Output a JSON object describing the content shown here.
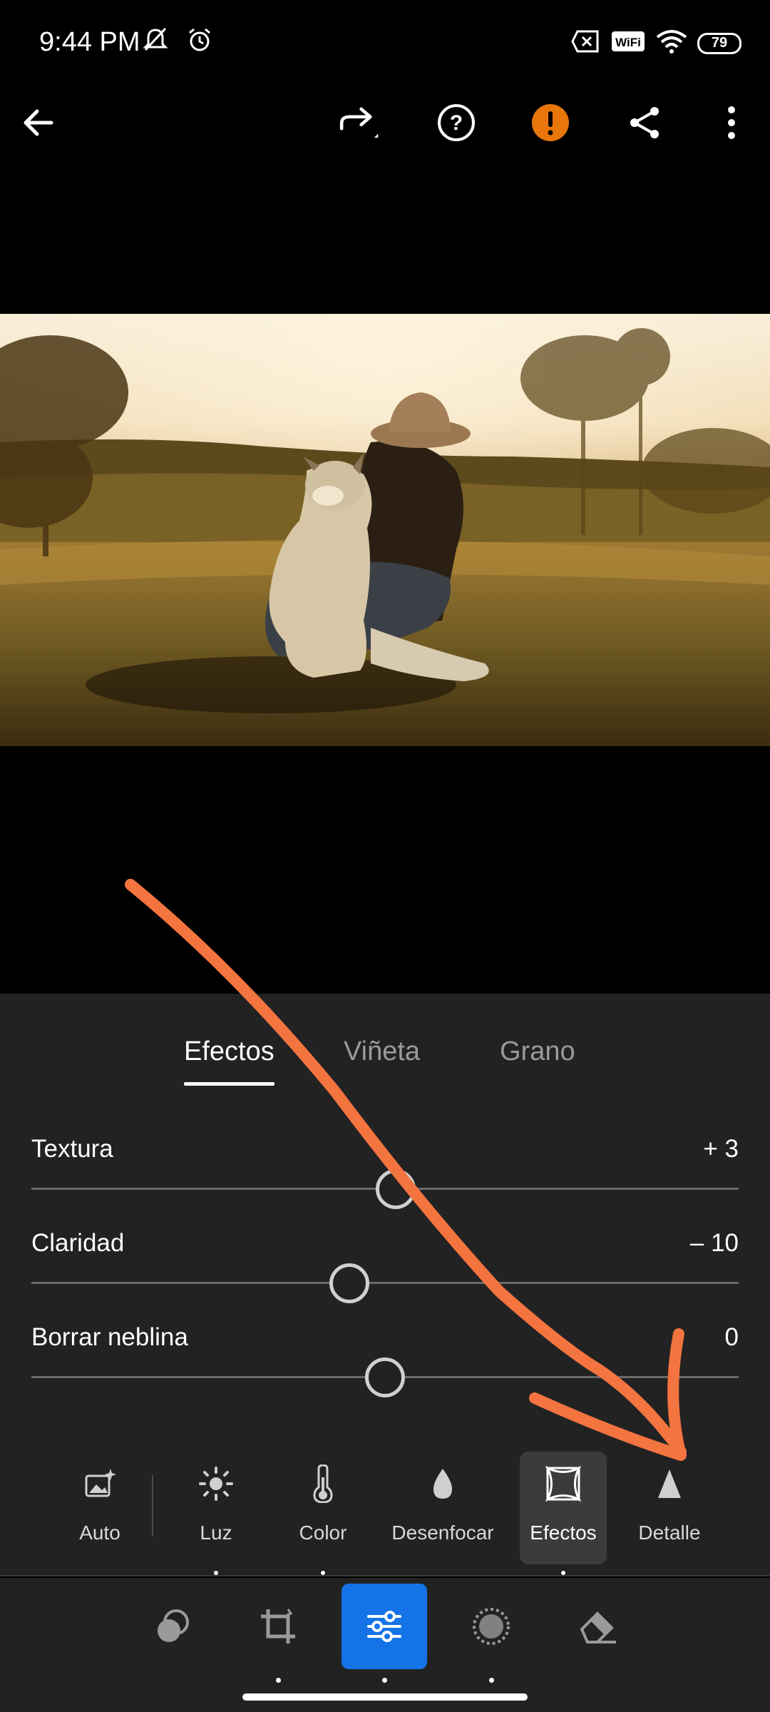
{
  "status_bar": {
    "time": "9:44 PM",
    "icons_left": [
      "mute-icon",
      "alarm-icon"
    ],
    "icons_right": [
      "no-sim-icon",
      "wifi-calling-icon",
      "wifi-icon"
    ],
    "battery": "79"
  },
  "toolbar": {
    "buttons": [
      "back-icon",
      "redo-icon",
      "help-icon",
      "warning-icon",
      "share-icon",
      "more-icon"
    ],
    "warning_color": "#e8760b"
  },
  "photo": {
    "description_icon": "photo-image"
  },
  "effects_panel": {
    "tabs": [
      {
        "label": "Efectos",
        "active": true
      },
      {
        "label": "Viñeta",
        "active": false
      },
      {
        "label": "Grano",
        "active": false
      }
    ],
    "sliders": [
      {
        "label": "Textura",
        "value": "+ 3",
        "numeric": 3
      },
      {
        "label": "Claridad",
        "value": "– 10",
        "numeric": -10
      },
      {
        "label": "Borrar neblina",
        "value": "0",
        "numeric": 0
      }
    ],
    "slider_range": [
      -100,
      100
    ]
  },
  "tools": {
    "items": [
      {
        "label": "Auto",
        "icon": "auto-icon",
        "active": false
      },
      {
        "label": "Luz",
        "icon": "light-icon",
        "active": false
      },
      {
        "label": "Color",
        "icon": "thermometer-icon",
        "active": false
      },
      {
        "label": "Desenfocar",
        "icon": "blur-drop-icon",
        "active": false
      },
      {
        "label": "Efectos",
        "icon": "effects-icon",
        "active": true
      },
      {
        "label": "Detalle",
        "icon": "detail-triangle-icon",
        "active": false
      }
    ]
  },
  "bottom_nav": {
    "items": [
      "presets-icon",
      "crop-icon",
      "edit-sliders-icon",
      "masking-icon",
      "healing-eraser-icon"
    ],
    "active_index": 2,
    "accent": "#1473e6"
  },
  "annotation": {
    "color": "#f47440"
  }
}
